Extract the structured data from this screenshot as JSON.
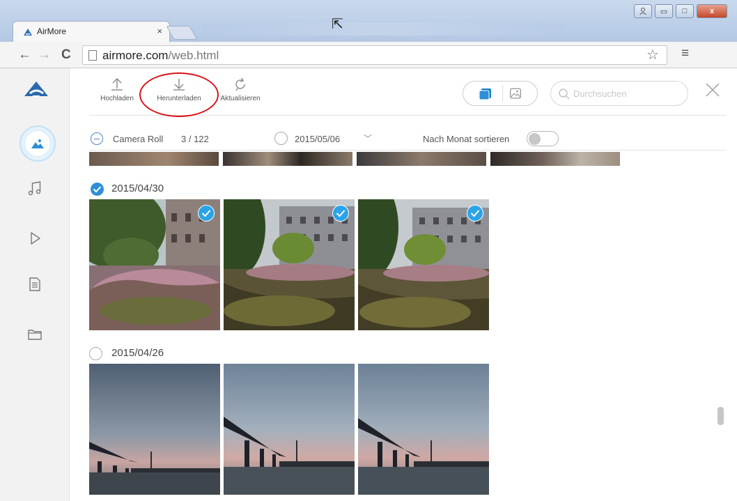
{
  "browser": {
    "tab_title": "AirMore",
    "tab_close": "×",
    "url_domain": "airmore.com",
    "url_path": "/web.html",
    "back": "←",
    "forward": "→",
    "reload": "C",
    "star": "☆",
    "menu": "≡",
    "minimize": "▭",
    "maximize": "□",
    "close": "x"
  },
  "toolbar": {
    "upload_label": "Hochladen",
    "download_label": "Herunterladen",
    "refresh_label": "Aktualisieren",
    "search_placeholder": "Durchsuchen"
  },
  "filter": {
    "album": "Camera Roll",
    "count": "3 / 122",
    "date": "2015/05/06",
    "sort_label": "Nach Monat sortieren",
    "sort_by_month": false
  },
  "groups": [
    {
      "date": "2015/04/30",
      "selected": true
    },
    {
      "date": "2015/04/26",
      "selected": false
    }
  ],
  "colors": {
    "accent": "#2e8fd6",
    "highlight_ring": "#d9141a"
  }
}
